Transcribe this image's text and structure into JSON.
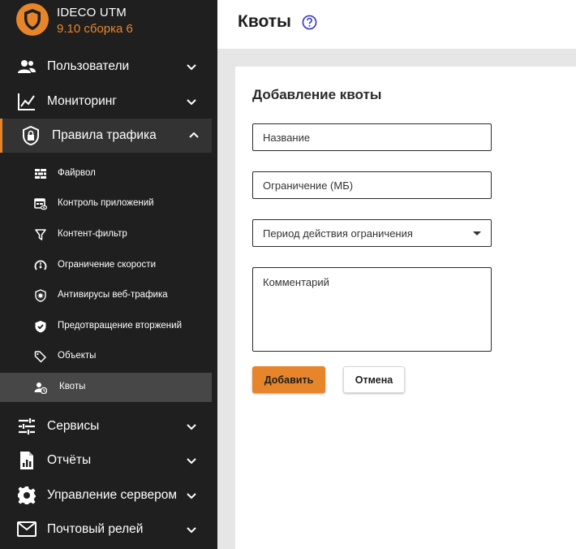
{
  "app": {
    "name": "IDECO UTM",
    "version": "9.10 сборка 6"
  },
  "nav": {
    "users": "Пользователи",
    "monitoring": "Мониторинг",
    "traffic_rules": "Правила трафика",
    "services": "Сервисы",
    "reports": "Отчёты",
    "server_management": "Управление сервером",
    "mail_relay": "Почтовый релей"
  },
  "subnav": {
    "firewall": "Файрвол",
    "app_control": "Контроль приложений",
    "content_filter": "Контент-фильтр",
    "speed_limit": "Ограничение скорости",
    "web_antivirus": "Антивирусы веб-трафика",
    "intrusion_prevention": "Предотвращение вторжений",
    "objects": "Объекты",
    "quotas": "Квоты"
  },
  "header": {
    "title": "Квоты",
    "help_icon": "question-circle-icon"
  },
  "form": {
    "title": "Добавление квоты",
    "name_placeholder": "Название",
    "limit_placeholder": "Ограничение (МБ)",
    "period_placeholder": "Период действия ограничения",
    "comment_placeholder": "Комментарий",
    "add_button": "Добавить",
    "cancel_button": "Отмена"
  },
  "colors": {
    "accent": "#e7852b",
    "sidebar_bg": "#1f1f1f",
    "active_bg": "#333333",
    "sub_active_bg": "#474747",
    "help": "#3f3fc4"
  }
}
